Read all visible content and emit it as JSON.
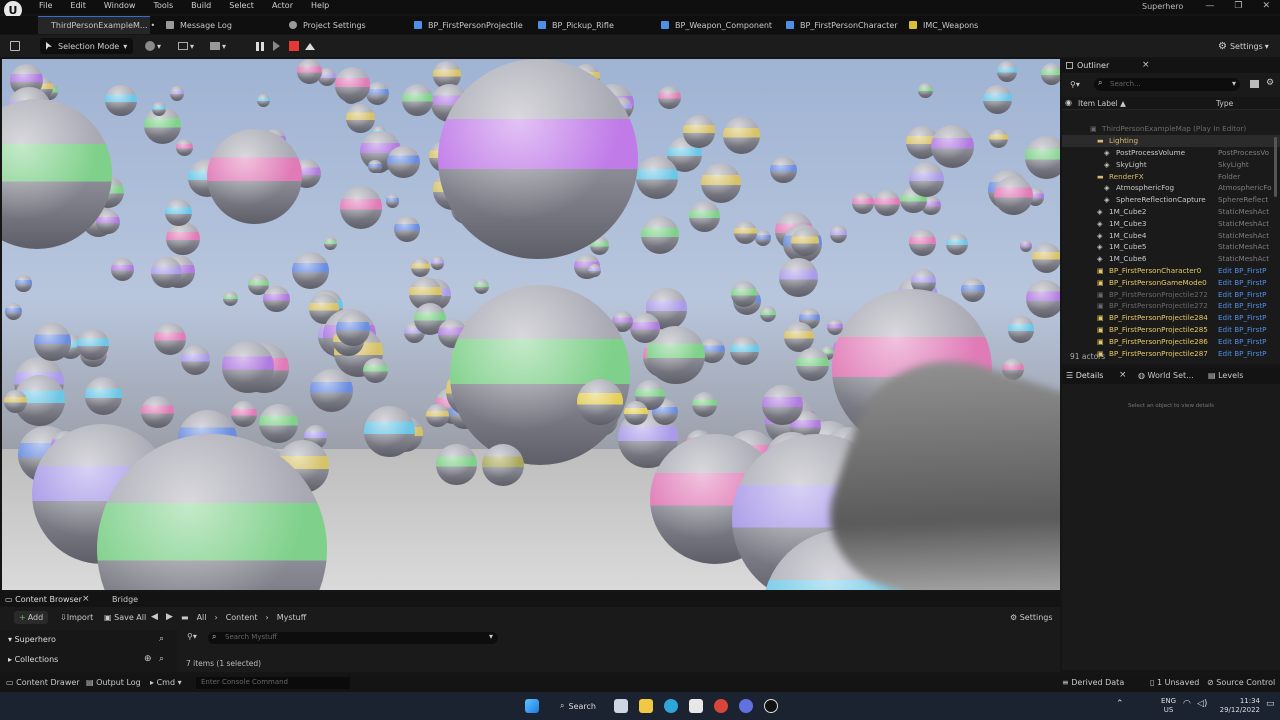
{
  "menubar": {
    "logo": "U",
    "items": [
      "File",
      "Edit",
      "Window",
      "Tools",
      "Build",
      "Select",
      "Actor",
      "Help"
    ],
    "project_name": "Superhero",
    "window_controls": [
      "—",
      "❐",
      "✕"
    ]
  },
  "tabs": [
    {
      "label": "ThirdPersonExampleM...",
      "dirty": "•",
      "icon_color": "#e1a52b"
    },
    {
      "label": "Message Log",
      "icon_color": "#9a9a9a"
    },
    {
      "label": "Project Settings",
      "icon_color": "#9a9a9a"
    },
    {
      "label": "BP_FirstPersonProjectile",
      "icon_color": "#4f8fe6"
    },
    {
      "label": "BP_Pickup_Rifle",
      "icon_color": "#4f8fe6"
    },
    {
      "label": "BP_Weapon_Component",
      "icon_color": "#4f8fe6"
    },
    {
      "label": "BP_FirstPersonCharacter",
      "icon_color": "#4f8fe6"
    },
    {
      "label": "IMC_Weapons",
      "icon_color": "#d6c034"
    }
  ],
  "toolbar": {
    "save_icon": "save-icon",
    "selection_mode": "Selection Mode",
    "settings_label": "Settings",
    "play_controls": [
      "pause",
      "step",
      "stop",
      "eject"
    ],
    "stop_color": "#e53935"
  },
  "outliner": {
    "title": "Outliner",
    "search_placeholder": "Search...",
    "col_label": "Item Label ▲",
    "col_type": "Type",
    "rows": [
      {
        "label": "ThirdPersonExampleMap (Play In Editor)",
        "type": "",
        "indent": 0,
        "tone": "dim"
      },
      {
        "label": "Lighting",
        "type": "",
        "indent": 1,
        "tone": "folder"
      },
      {
        "label": "PostProcessVolume",
        "type": "PostProcessVo",
        "indent": 2,
        "tone": "normal"
      },
      {
        "label": "SkyLight",
        "type": "SkyLight",
        "indent": 2,
        "tone": "normal"
      },
      {
        "label": "RenderFX",
        "type": "Folder",
        "indent": 1,
        "tone": "folder"
      },
      {
        "label": "AtmosphericFog",
        "type": "AtmosphericFo",
        "indent": 2,
        "tone": "normal"
      },
      {
        "label": "SphereReflectionCapture",
        "type": "SphereReflect",
        "indent": 2,
        "tone": "normal"
      },
      {
        "label": "1M_Cube2",
        "type": "StaticMeshAct",
        "indent": 1,
        "tone": "normal"
      },
      {
        "label": "1M_Cube3",
        "type": "StaticMeshAct",
        "indent": 1,
        "tone": "normal"
      },
      {
        "label": "1M_Cube4",
        "type": "StaticMeshAct",
        "indent": 1,
        "tone": "normal"
      },
      {
        "label": "1M_Cube5",
        "type": "StaticMeshAct",
        "indent": 1,
        "tone": "normal"
      },
      {
        "label": "1M_Cube6",
        "type": "StaticMeshAct",
        "indent": 1,
        "tone": "normal"
      },
      {
        "label": "BP_FirstPersonCharacter0",
        "type": "Edit BP_FirstP",
        "indent": 1,
        "tone": "yellow"
      },
      {
        "label": "BP_FirstPersonGameMode0",
        "type": "Edit BP_FirstP",
        "indent": 1,
        "tone": "yellow"
      },
      {
        "label": "BP_FirstPersonProjectile272",
        "type": "Edit BP_FirstP",
        "indent": 1,
        "tone": "dim"
      },
      {
        "label": "BP_FirstPersonProjectile272",
        "type": "Edit BP_FirstP",
        "indent": 1,
        "tone": "dim"
      },
      {
        "label": "BP_FirstPersonProjectile284",
        "type": "Edit BP_FirstP",
        "indent": 1,
        "tone": "yellow"
      },
      {
        "label": "BP_FirstPersonProjectile285",
        "type": "Edit BP_FirstP",
        "indent": 1,
        "tone": "yellow"
      },
      {
        "label": "BP_FirstPersonProjectile286",
        "type": "Edit BP_FirstP",
        "indent": 1,
        "tone": "yellow"
      },
      {
        "label": "BP_FirstPersonProjectile287",
        "type": "Edit BP_FirstP",
        "indent": 1,
        "tone": "yellow"
      }
    ],
    "actor_count": "91 actors"
  },
  "details": {
    "tabs": [
      "Details",
      "World Set...",
      "Levels"
    ],
    "empty_message": "Select an object to view details"
  },
  "content_browser": {
    "tabs": [
      "Content Browser",
      "Bridge"
    ],
    "add_label": "Add",
    "import_label": "Import",
    "save_all_label": "Save All",
    "path": [
      "All",
      "Content",
      "Mystuff"
    ],
    "settings_label": "Settings",
    "project_folder": "Superhero",
    "collections": "Collections",
    "search_placeholder": "Search Mystuff",
    "item_count": "7 items (1 selected)"
  },
  "statusbar": {
    "content_drawer": "Content Drawer",
    "output_log": "Output Log",
    "cmd": "Cmd",
    "console_placeholder": "Enter Console Command",
    "derived_data": "Derived Data",
    "unsaved": "1 Unsaved",
    "source_control": "Source Control"
  },
  "taskbar": {
    "search_label": "Search",
    "lang": "ENG",
    "region": "US",
    "time": "11:34",
    "date": "29/12/2022"
  }
}
